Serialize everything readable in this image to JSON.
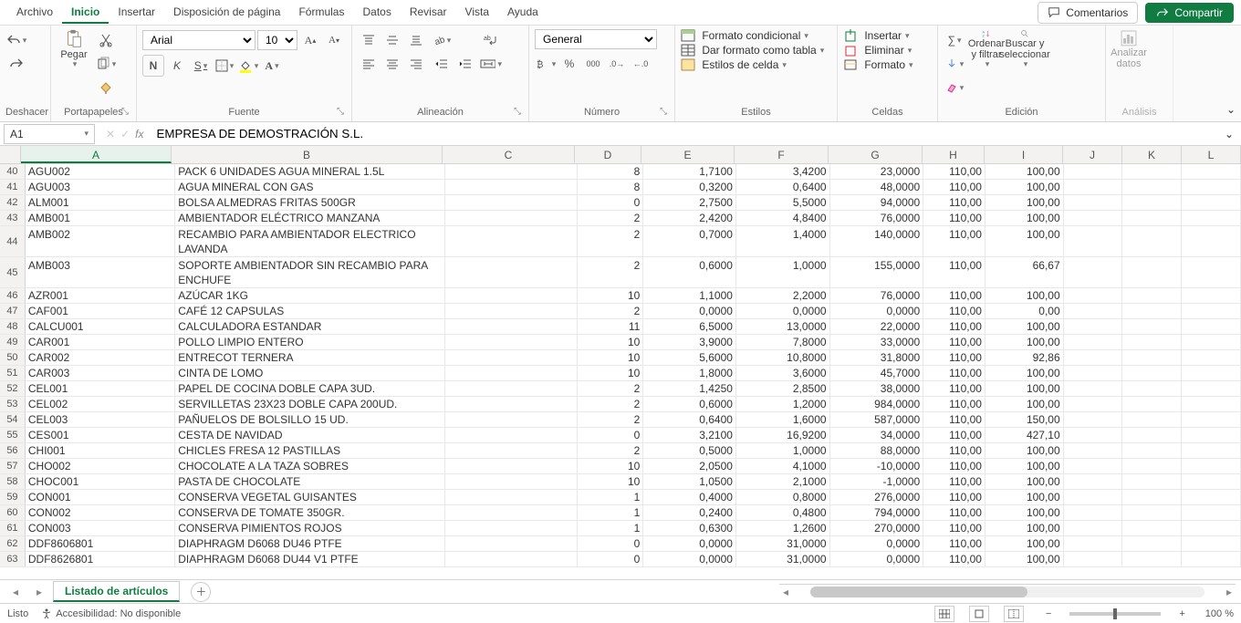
{
  "menu": {
    "items": [
      "Archivo",
      "Inicio",
      "Insertar",
      "Disposición de página",
      "Fórmulas",
      "Datos",
      "Revisar",
      "Vista",
      "Ayuda"
    ],
    "activeIndex": 1
  },
  "header_buttons": {
    "comments": "Comentarios",
    "share": "Compartir"
  },
  "ribbon": {
    "undo_group": "Deshacer",
    "clipboard": {
      "label": "Portapapeles",
      "paste": "Pegar"
    },
    "font": {
      "label": "Fuente",
      "name": "Arial",
      "size": "10",
      "bold": "N",
      "italic": "K",
      "underline": "S"
    },
    "alignment": {
      "label": "Alineación"
    },
    "number": {
      "label": "Número",
      "format": "General"
    },
    "styles": {
      "label": "Estilos",
      "cond": "Formato condicional",
      "table": "Dar formato como tabla",
      "cell": "Estilos de celda"
    },
    "cells": {
      "label": "Celdas",
      "insert": "Insertar",
      "delete": "Eliminar",
      "format": "Formato"
    },
    "editing": {
      "label": "Edición",
      "sort": "Ordenar y filtrar",
      "find": "Buscar y seleccionar"
    },
    "analysis": {
      "label": "Análisis",
      "analyze": "Analizar datos"
    }
  },
  "namebox": "A1",
  "formula": "EMPRESA DE DEMOSTRACIÓN S.L.",
  "columns": [
    "A",
    "B",
    "C",
    "D",
    "E",
    "F",
    "G",
    "H",
    "I",
    "J",
    "K",
    "L"
  ],
  "rows": [
    {
      "n": 40,
      "a": "AGU002",
      "b": "PACK 6 UNIDADES AGUA MINERAL 1.5L",
      "d": "8",
      "e": "1,7100",
      "f": "3,4200",
      "g": "23,0000",
      "h": "110,00",
      "i": "100,00"
    },
    {
      "n": 41,
      "a": "AGU003",
      "b": "AGUA MINERAL CON GAS",
      "d": "8",
      "e": "0,3200",
      "f": "0,6400",
      "g": "48,0000",
      "h": "110,00",
      "i": "100,00"
    },
    {
      "n": 42,
      "a": "ALM001",
      "b": "BOLSA ALMEDRAS FRITAS 500GR",
      "d": "0",
      "e": "2,7500",
      "f": "5,5000",
      "g": "94,0000",
      "h": "110,00",
      "i": "100,00"
    },
    {
      "n": 43,
      "a": "AMB001",
      "b": "AMBIENTADOR ELÉCTRICO MANZANA",
      "d": "2",
      "e": "2,4200",
      "f": "4,8400",
      "g": "76,0000",
      "h": "110,00",
      "i": "100,00"
    },
    {
      "n": 44,
      "a": "AMB002",
      "b": "RECAMBIO PARA AMBIENTADOR ELECTRICO LAVANDA",
      "d": "2",
      "e": "0,7000",
      "f": "1,4000",
      "g": "140,0000",
      "h": "110,00",
      "i": "100,00",
      "tall": true
    },
    {
      "n": 45,
      "a": "AMB003",
      "b": "SOPORTE AMBIENTADOR SIN RECAMBIO PARA ENCHUFE",
      "d": "2",
      "e": "0,6000",
      "f": "1,0000",
      "g": "155,0000",
      "h": "110,00",
      "i": "66,67",
      "tall": true
    },
    {
      "n": 46,
      "a": "AZR001",
      "b": "AZÚCAR 1KG",
      "d": "10",
      "e": "1,1000",
      "f": "2,2000",
      "g": "76,0000",
      "h": "110,00",
      "i": "100,00"
    },
    {
      "n": 47,
      "a": "CAF001",
      "b": "CAFÉ 12 CAPSULAS",
      "d": "2",
      "e": "0,0000",
      "f": "0,0000",
      "g": "0,0000",
      "h": "110,00",
      "i": "0,00"
    },
    {
      "n": 48,
      "a": "CALCU001",
      "b": "CALCULADORA ESTANDAR",
      "d": "11",
      "e": "6,5000",
      "f": "13,0000",
      "g": "22,0000",
      "h": "110,00",
      "i": "100,00"
    },
    {
      "n": 49,
      "a": "CAR001",
      "b": "POLLO LIMPIO ENTERO",
      "d": "10",
      "e": "3,9000",
      "f": "7,8000",
      "g": "33,0000",
      "h": "110,00",
      "i": "100,00"
    },
    {
      "n": 50,
      "a": "CAR002",
      "b": "ENTRECOT TERNERA",
      "d": "10",
      "e": "5,6000",
      "f": "10,8000",
      "g": "31,8000",
      "h": "110,00",
      "i": "92,86"
    },
    {
      "n": 51,
      "a": "CAR003",
      "b": "CINTA DE LOMO",
      "d": "10",
      "e": "1,8000",
      "f": "3,6000",
      "g": "45,7000",
      "h": "110,00",
      "i": "100,00"
    },
    {
      "n": 52,
      "a": "CEL001",
      "b": "PAPEL DE COCINA DOBLE CAPA 3UD.",
      "d": "2",
      "e": "1,4250",
      "f": "2,8500",
      "g": "38,0000",
      "h": "110,00",
      "i": "100,00"
    },
    {
      "n": 53,
      "a": "CEL002",
      "b": "SERVILLETAS 23X23 DOBLE CAPA 200UD.",
      "d": "2",
      "e": "0,6000",
      "f": "1,2000",
      "g": "984,0000",
      "h": "110,00",
      "i": "100,00"
    },
    {
      "n": 54,
      "a": "CEL003",
      "b": "PAÑUELOS DE BOLSILLO 15 UD.",
      "d": "2",
      "e": "0,6400",
      "f": "1,6000",
      "g": "587,0000",
      "h": "110,00",
      "i": "150,00"
    },
    {
      "n": 55,
      "a": "CES001",
      "b": "CESTA DE NAVIDAD",
      "d": "0",
      "e": "3,2100",
      "f": "16,9200",
      "g": "34,0000",
      "h": "110,00",
      "i": "427,10"
    },
    {
      "n": 56,
      "a": "CHI001",
      "b": "CHICLES FRESA 12 PASTILLAS",
      "d": "2",
      "e": "0,5000",
      "f": "1,0000",
      "g": "88,0000",
      "h": "110,00",
      "i": "100,00"
    },
    {
      "n": 57,
      "a": "CHO002",
      "b": "CHOCOLATE A LA TAZA SOBRES",
      "d": "10",
      "e": "2,0500",
      "f": "4,1000",
      "g": "-10,0000",
      "h": "110,00",
      "i": "100,00"
    },
    {
      "n": 58,
      "a": "CHOC001",
      "b": "PASTA DE CHOCOLATE",
      "d": "10",
      "e": "1,0500",
      "f": "2,1000",
      "g": "-1,0000",
      "h": "110,00",
      "i": "100,00"
    },
    {
      "n": 59,
      "a": "CON001",
      "b": "CONSERVA VEGETAL GUISANTES",
      "d": "1",
      "e": "0,4000",
      "f": "0,8000",
      "g": "276,0000",
      "h": "110,00",
      "i": "100,00"
    },
    {
      "n": 60,
      "a": "CON002",
      "b": "CONSERVA DE TOMATE 350GR.",
      "d": "1",
      "e": "0,2400",
      "f": "0,4800",
      "g": "794,0000",
      "h": "110,00",
      "i": "100,00"
    },
    {
      "n": 61,
      "a": "CON003",
      "b": "CONSERVA PIMIENTOS ROJOS",
      "d": "1",
      "e": "0,6300",
      "f": "1,2600",
      "g": "270,0000",
      "h": "110,00",
      "i": "100,00"
    },
    {
      "n": 62,
      "a": "DDF8606801",
      "b": "DIAPHRAGM D6068 DU46               PTFE",
      "d": "0",
      "e": "0,0000",
      "f": "31,0000",
      "g": "0,0000",
      "h": "110,00",
      "i": "100,00"
    },
    {
      "n": 63,
      "a": "DDF8626801",
      "b": "DIAPHRAGM D6068 DU44 V1            PTFE",
      "d": "0",
      "e": "0,0000",
      "f": "31,0000",
      "g": "0,0000",
      "h": "110,00",
      "i": "100,00"
    }
  ],
  "sheet_tab": "Listado de artículos",
  "status": {
    "ready": "Listo",
    "acc": "Accesibilidad: No disponible",
    "zoom": "100 %"
  }
}
